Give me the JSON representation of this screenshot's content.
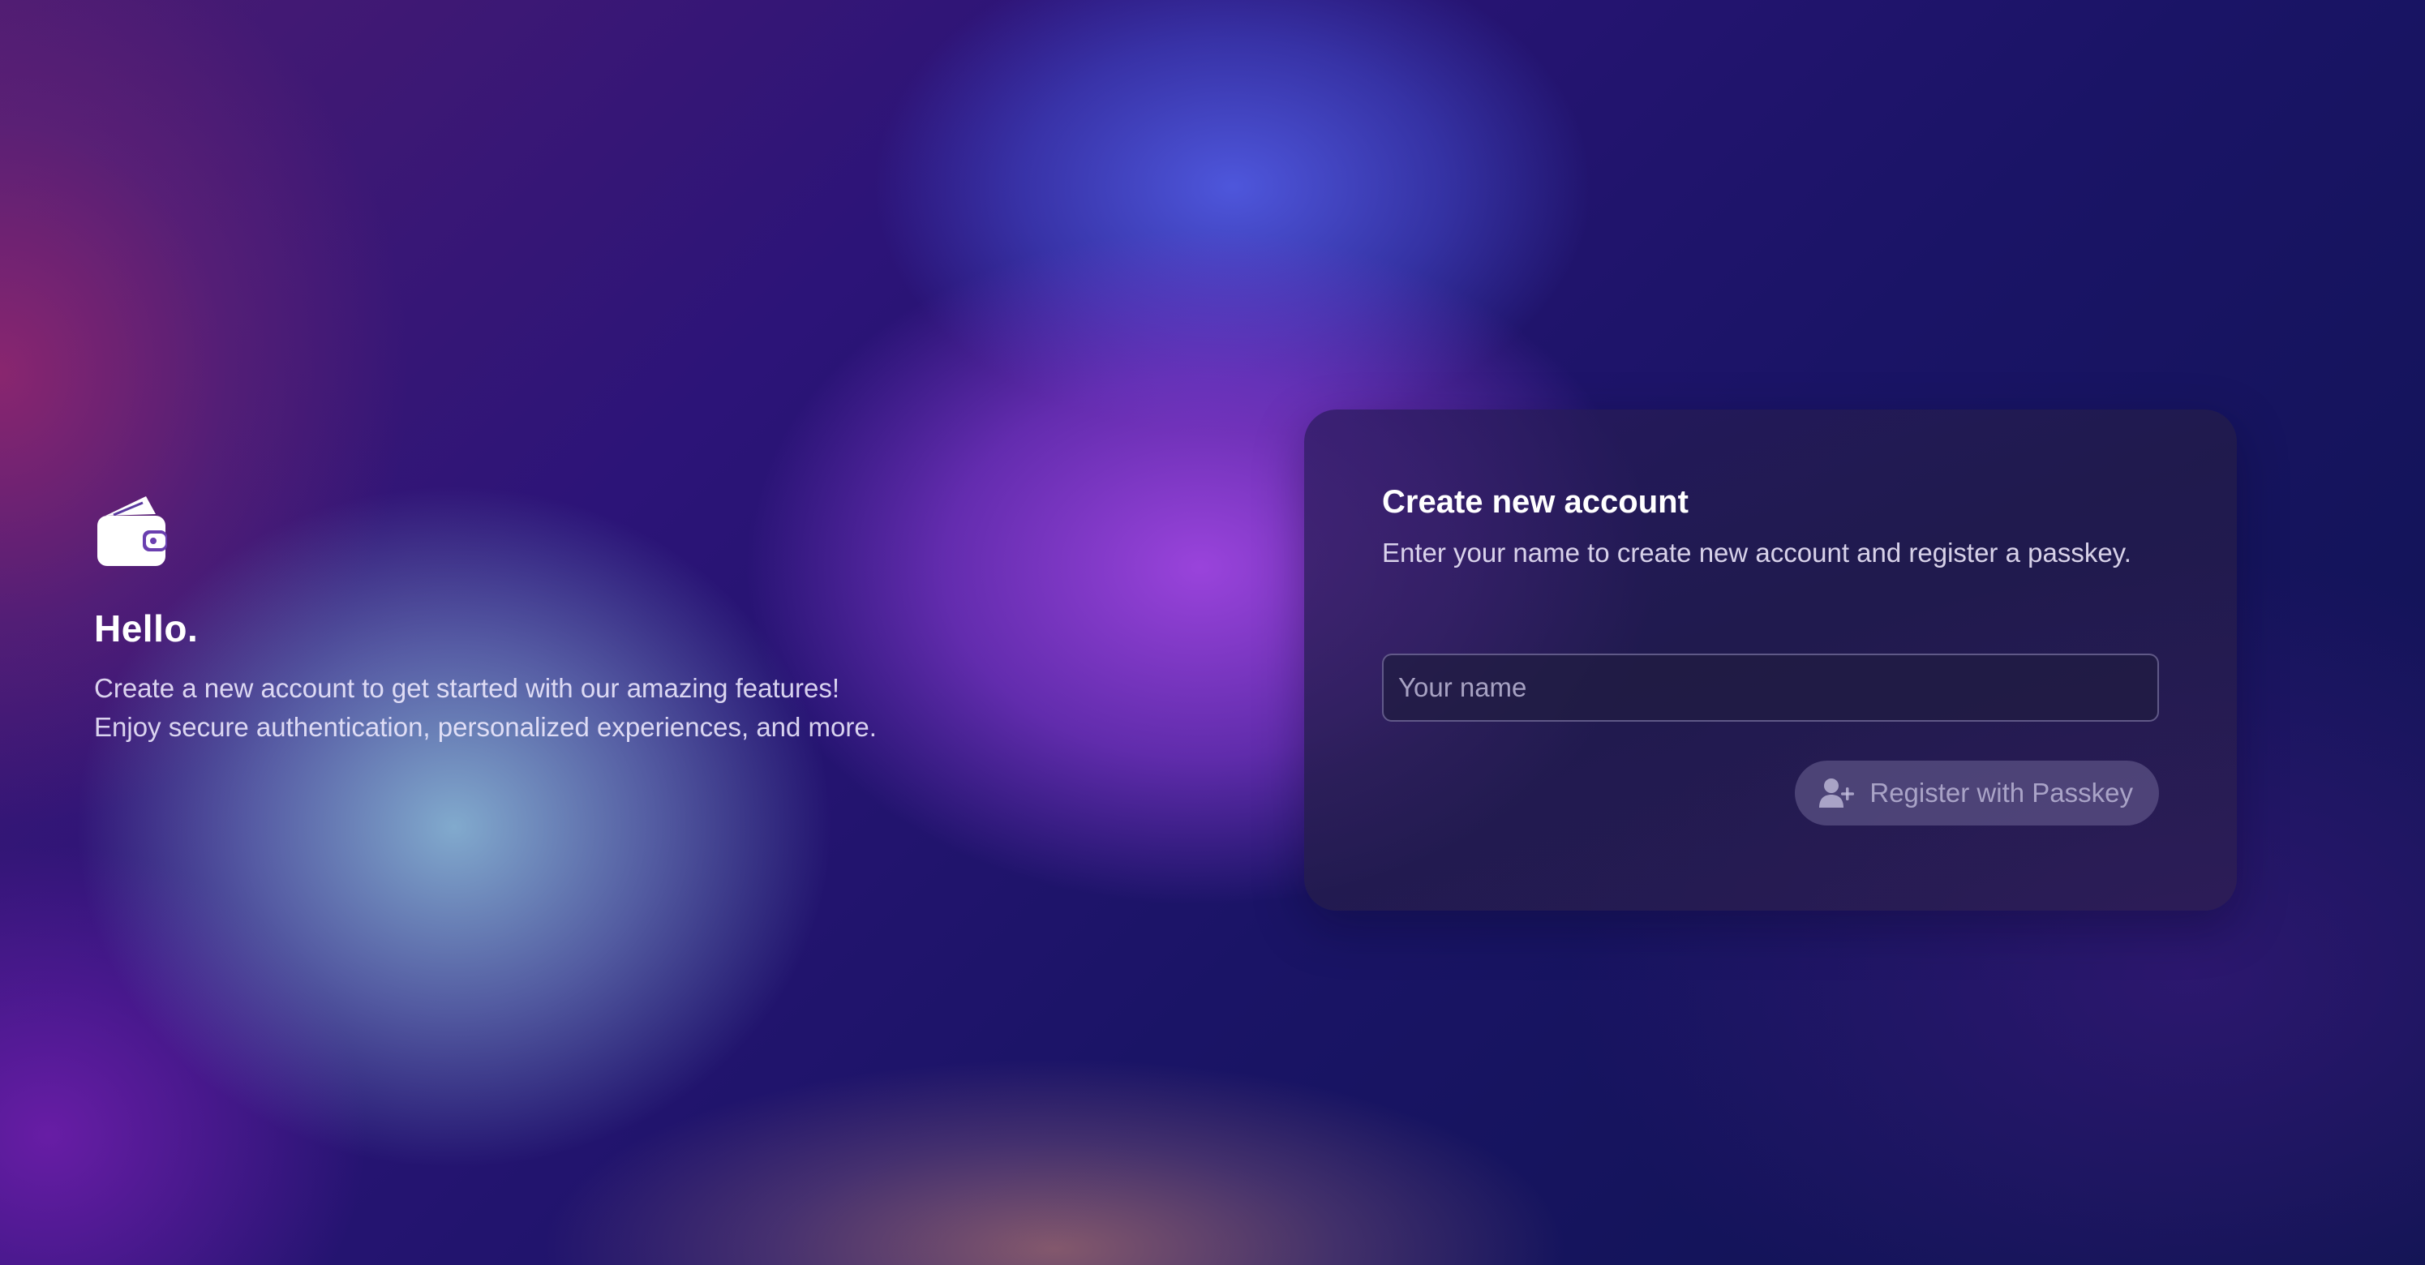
{
  "hero": {
    "icon": "wallet-icon",
    "title": "Hello.",
    "description_line1": "Create a new account to get started with our amazing features!",
    "description_line2": "Enjoy secure authentication, personalized experiences, and more."
  },
  "card": {
    "title": "Create new account",
    "subtitle": "Enter your name to create new account and register a passkey.",
    "name_input": {
      "placeholder": "Your name",
      "value": ""
    },
    "register_button": {
      "icon": "user-plus-icon",
      "label": "Register with Passkey",
      "state": "disabled"
    }
  }
}
